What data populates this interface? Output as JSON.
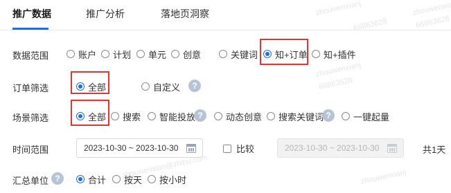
{
  "tabs": [
    {
      "label": "推广数据",
      "active": true
    },
    {
      "label": "推广分析",
      "active": false
    },
    {
      "label": "落地页洞察",
      "active": false
    }
  ],
  "data_scope": {
    "label": "数据范围",
    "options": [
      "账户",
      "计划",
      "单元",
      "创意",
      "关键词",
      "知+订单",
      "知+插件"
    ],
    "selected": "知+订单"
  },
  "order_filter": {
    "label": "订单筛选",
    "options": [
      "全部",
      "自定义"
    ],
    "selected": "全部",
    "help_icon": "?"
  },
  "scene_filter": {
    "label": "场景筛选",
    "options": [
      "全部",
      "搜索",
      "智能投放",
      "动态创意",
      "搜索关键词",
      "一键起量"
    ],
    "selected": "全部",
    "help_icon": "?"
  },
  "time_range": {
    "label": "时间范围",
    "date_value": "2023-10-30 ~ 2023-10-30",
    "compare_label": "比较",
    "compare_checked": false,
    "compare_date_value": "2023-10-30 ~ 2023-10-30",
    "total_days": "共1天"
  },
  "summary_unit": {
    "label": "汇总单位",
    "help_icon": "?",
    "options": [
      "合计",
      "按天",
      "按小时"
    ],
    "selected": "合计"
  },
  "watermark": {
    "user": "zhouwenxianj",
    "email": "zhouwenxian@zhihu.com",
    "id": "66863628"
  },
  "colors": {
    "accent": "#1f6fe0",
    "highlight_box": "#e8322a"
  }
}
